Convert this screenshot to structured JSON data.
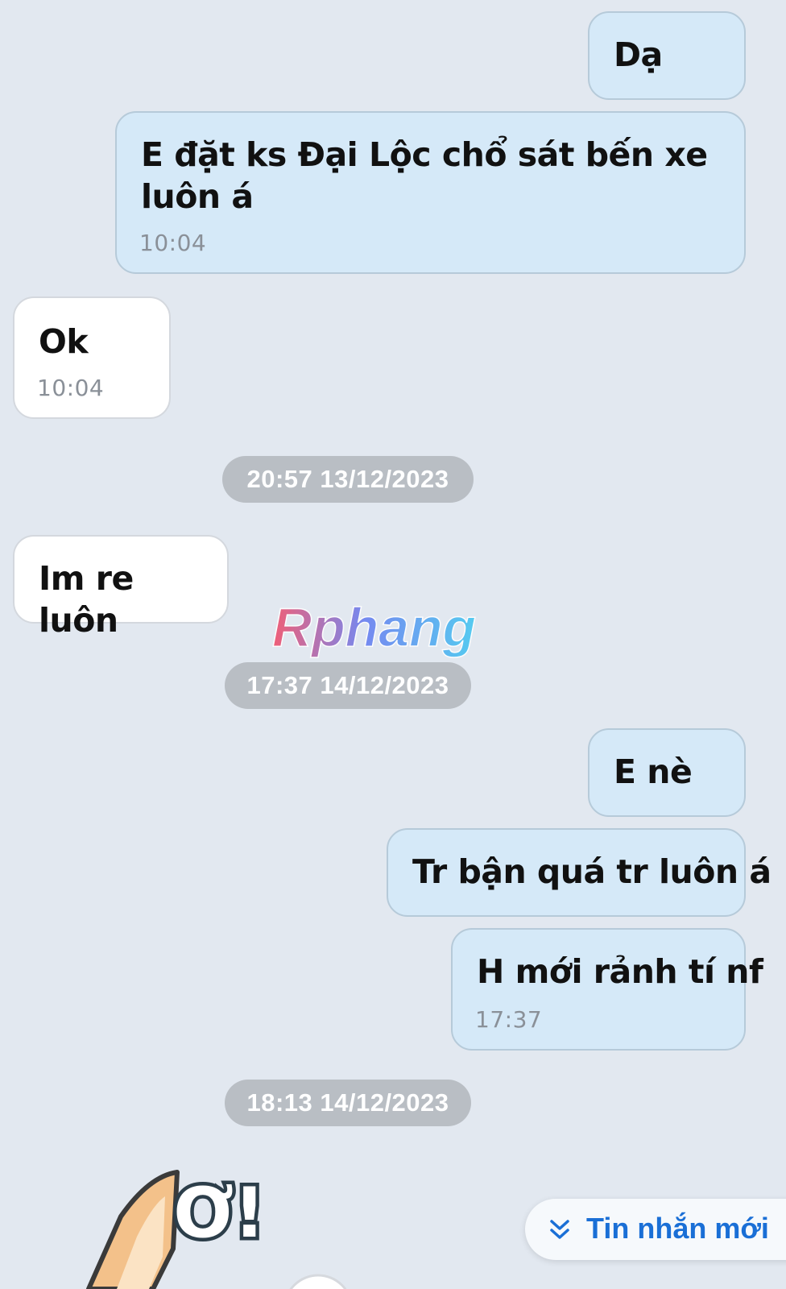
{
  "messages": [
    {
      "side": "out",
      "text": "Dạ",
      "time": ""
    },
    {
      "side": "out",
      "text": "E đặt ks Đại Lộc chổ sát bến xe luôn á",
      "time": "10:04"
    },
    {
      "side": "in",
      "text": "Ok",
      "time": "10:04"
    },
    {
      "side": "in",
      "text": "Im re luôn",
      "time": ""
    },
    {
      "side": "out",
      "text": "E nè",
      "time": ""
    },
    {
      "side": "out",
      "text": "Tr bận quá tr luôn á",
      "time": ""
    },
    {
      "side": "out",
      "text": "H mới rảnh tí nf",
      "time": "17:37"
    }
  ],
  "date_separators": [
    "20:57 13/12/2023",
    "17:37 14/12/2023",
    "18:13 14/12/2023"
  ],
  "watermark": {
    "text": "Rphang"
  },
  "new_message_button": {
    "label": "Tin nhắn mới",
    "icon": "double-chevron-down-icon"
  },
  "sticker": {
    "text": "Ơ!",
    "icon": "fox-sticker-icon"
  },
  "colors": {
    "background": "#e2e8f0",
    "outgoing_bubble": "#d5e9f8",
    "incoming_bubble": "#ffffff",
    "date_pill": "#b9bec4",
    "accent": "#1a6fd6"
  }
}
